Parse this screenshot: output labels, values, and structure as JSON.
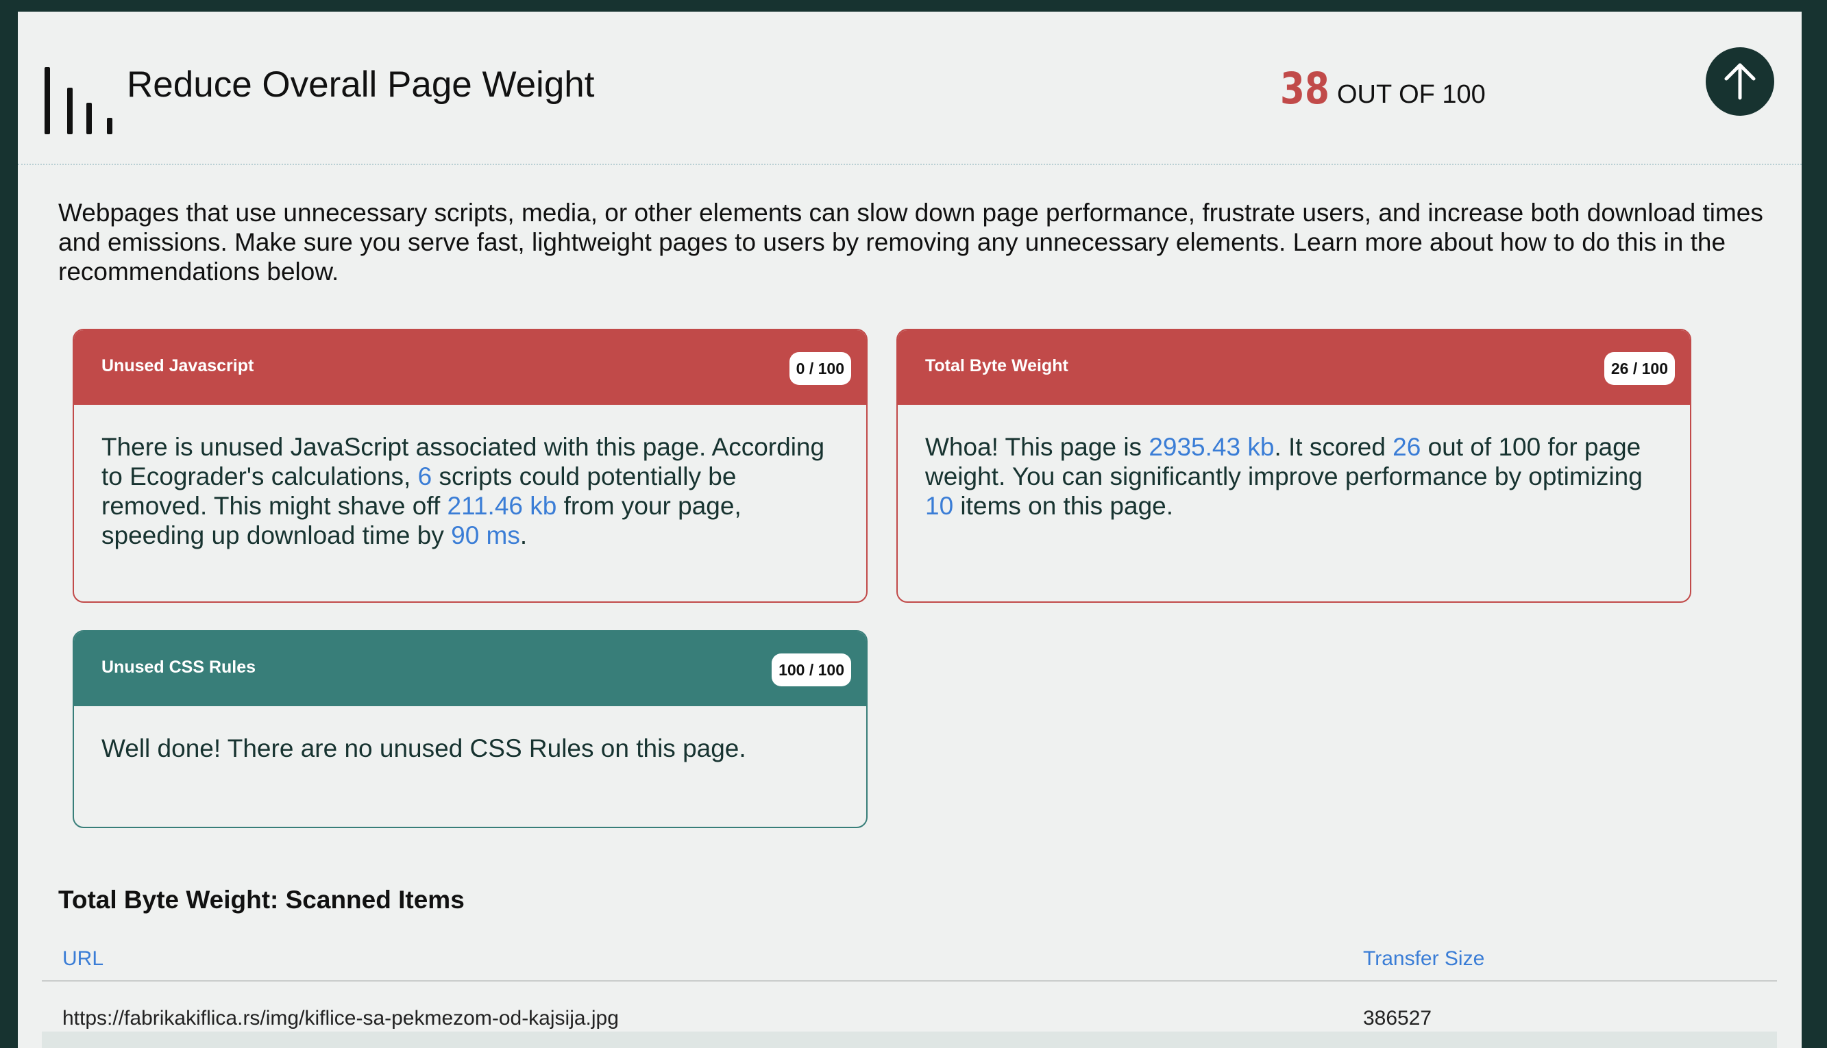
{
  "header": {
    "title": "Reduce Overall Page Weight",
    "score_value": "38",
    "score_suffix": "OUT OF 100",
    "top_button_icon": "arrow-up-icon"
  },
  "intro": "Webpages that use unnecessary scripts, media, or other elements can slow down page performance, frustrate users, and increase both download times and emissions. Make sure you serve fast, lightweight pages to users by removing any unnecessary elements. Learn more about how to do this in the recommendations below.",
  "colors": {
    "fail": "#c14a49",
    "pass": "#387e79",
    "highlight": "#3a7dd6",
    "dark": "#173330"
  },
  "cards": {
    "unused_js": {
      "title": "Unused Javascript",
      "score": "0 / 100",
      "status": "fail",
      "t1": "There is unused JavaScript associated with this page. According to Ecograder's calculations, ",
      "v1": "6",
      "t2": " scripts could potentially be removed. This might shave off ",
      "v2": "211.46 kb",
      "t3": " from your page, speeding up download time by ",
      "v3": "90 ms",
      "t4": "."
    },
    "total_byte": {
      "title": "Total Byte Weight",
      "score": "26 / 100",
      "status": "fail",
      "t1": "Whoa! This page is ",
      "v1": "2935.43 kb",
      "t2": ". It scored ",
      "v2": "26",
      "t3": " out of 100 for page weight. You can significantly improve performance by optimizing ",
      "v3": "10",
      "t4": " items on this page."
    },
    "unused_css": {
      "title": "Unused CSS Rules",
      "score": "100 / 100",
      "status": "pass",
      "t1": "Well done! There are no unused CSS Rules on this page."
    }
  },
  "scanned": {
    "title": "Total Byte Weight: Scanned Items",
    "columns": [
      "URL",
      "Transfer Size"
    ],
    "rows": [
      [
        "https://fabrikakiflica.rs/img/kiflice-sa-pekmezom-od-kajsija.jpg",
        "386527"
      ]
    ]
  }
}
